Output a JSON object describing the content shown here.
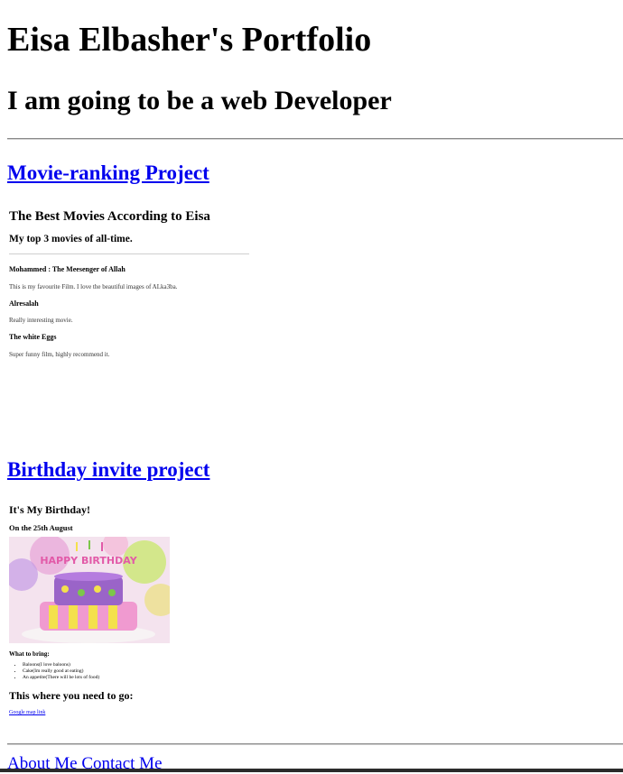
{
  "header": {
    "title": "Eisa Elbasher's Portfolio",
    "subtitle": "I am going to be a web Developer"
  },
  "projects": [
    {
      "link_label": "Movie-ranking Project",
      "frame": {
        "heading": "The Best Movies According to Eisa",
        "subheading": "My top 3 movies of all-time.",
        "movies": [
          {
            "title": "Mohammed : The Meesenger of Allah",
            "desc": "This is my favourite Film. I love the beautiful images of ALka3ba."
          },
          {
            "title": "Alresalah",
            "desc": "Really interesting movie."
          },
          {
            "title": "The white Eggs",
            "desc": "Super funny film, highly recommend it."
          }
        ]
      }
    },
    {
      "link_label": "Birthday invite project",
      "frame": {
        "heading": "It's My Birthday!",
        "date": "On the 25th August",
        "cake_text": "HAPPY BIRTHDAY",
        "bring_label": "What to bring:",
        "bring_items": [
          "Baloons(I love baloons)",
          "Cake(Im really good at eating)",
          "An appetite(There will be lots of food)"
        ],
        "location_heading": "This where you need to go:",
        "map_link": "Google map link"
      }
    }
  ],
  "footer": {
    "about": "About Me",
    "contact": "Contact Me"
  }
}
